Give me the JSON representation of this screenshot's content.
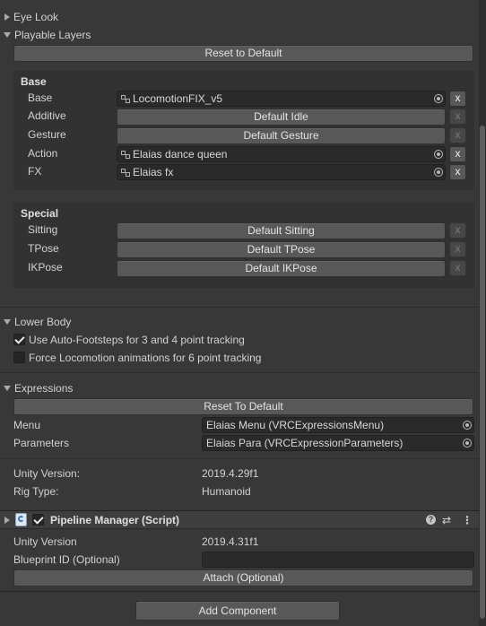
{
  "foldouts": {
    "eye_look": "Eye Look",
    "playable_layers": "Playable Layers",
    "lower_body": "Lower Body",
    "expressions": "Expressions"
  },
  "playable_layers": {
    "reset_button": "Reset to Default",
    "base_section": {
      "title": "Base",
      "rows": [
        {
          "label": "Base",
          "value": "LocomotionFIX_v5",
          "kind": "field"
        },
        {
          "label": "Additive",
          "value": "Default Idle",
          "kind": "button"
        },
        {
          "label": "Gesture",
          "value": "Default Gesture",
          "kind": "button"
        },
        {
          "label": "Action",
          "value": "Elaias dance queen",
          "kind": "field"
        },
        {
          "label": "FX",
          "value": "Elaias fx",
          "kind": "field"
        }
      ]
    },
    "special_section": {
      "title": "Special",
      "rows": [
        {
          "label": "Sitting",
          "value": "Default Sitting",
          "kind": "button"
        },
        {
          "label": "TPose",
          "value": "Default TPose",
          "kind": "button"
        },
        {
          "label": "IKPose",
          "value": "Default IKPose",
          "kind": "button"
        }
      ]
    },
    "remove_label": "x"
  },
  "lower_body": {
    "auto_footsteps": {
      "label": "Use Auto-Footsteps for 3 and 4 point tracking",
      "checked": true
    },
    "force_locomotion": {
      "label": "Force Locomotion animations for 6 point tracking",
      "checked": false
    }
  },
  "expressions": {
    "reset_button": "Reset To Default",
    "menu_label": "Menu",
    "menu_value": "Elaias Menu (VRCExpressionsMenu)",
    "parameters_label": "Parameters",
    "parameters_value": "Elaias Para (VRCExpressionParameters)"
  },
  "info": {
    "unity_version_label": "Unity Version:",
    "unity_version_value": "2019.4.29f1",
    "rig_type_label": "Rig Type:",
    "rig_type_value": "Humanoid"
  },
  "pipeline_manager": {
    "title": "Pipeline Manager (Script)",
    "enabled": true,
    "unity_version_label": "Unity Version",
    "unity_version_value": "2019.4.31f1",
    "blueprint_label": "Blueprint ID (Optional)",
    "blueprint_value": "",
    "attach_button": "Attach (Optional)",
    "help_icon": "?",
    "presets_icon": "⇄",
    "menu_icon": "⋮"
  },
  "add_component": "Add Component"
}
